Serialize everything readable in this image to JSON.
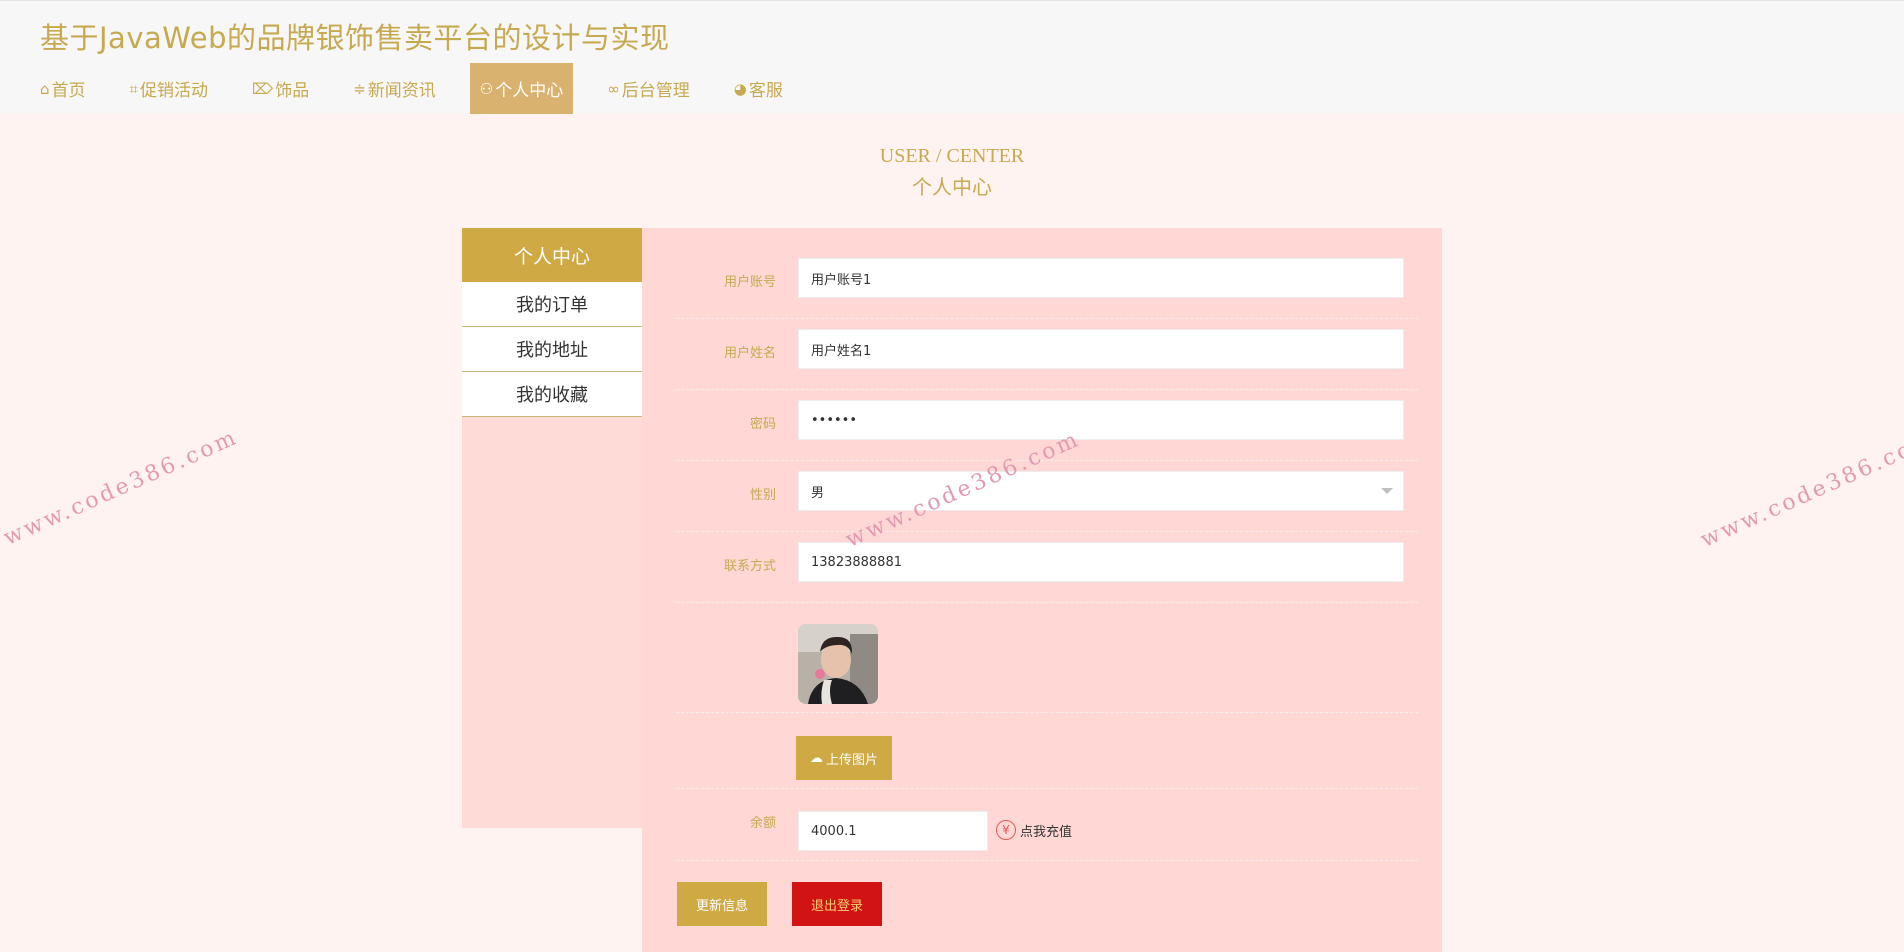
{
  "site": {
    "title": "基于JavaWeb的品牌银饰售卖平台的设计与实现"
  },
  "nav": [
    {
      "label": "首页",
      "icon": "home-icon",
      "glyph": "⌂"
    },
    {
      "label": "促销活动",
      "icon": "promo-icon",
      "glyph": "⌗"
    },
    {
      "label": "饰品",
      "icon": "tag-icon",
      "glyph": "⌦"
    },
    {
      "label": "新闻资讯",
      "icon": "sliders-icon",
      "glyph": "≑"
    },
    {
      "label": "个人中心",
      "icon": "user-icon",
      "glyph": "⚇",
      "active": true
    },
    {
      "label": "后台管理",
      "icon": "link-icon",
      "glyph": "∞"
    },
    {
      "label": "客服",
      "icon": "chat-icon",
      "glyph": "◕"
    }
  ],
  "section": {
    "en": "USER / CENTER",
    "cn": "个人中心"
  },
  "sidebar": {
    "header": "个人中心",
    "items": [
      "我的订单",
      "我的地址",
      "我的收藏"
    ]
  },
  "form": {
    "account": {
      "label": "用户账号",
      "value": "用户账号1"
    },
    "name": {
      "label": "用户姓名",
      "value": "用户姓名1"
    },
    "password": {
      "label": "密码",
      "value": "••••••"
    },
    "gender": {
      "label": "性别",
      "value": "男"
    },
    "contact": {
      "label": "联系方式",
      "value": "13823888881"
    },
    "upload_label": "上传图片",
    "balance": {
      "label": "余额",
      "value": "4000.1"
    },
    "recharge_label": "点我充值",
    "update_label": "更新信息",
    "logout_label": "退出登录"
  },
  "watermark": "www.code386.com",
  "colors": {
    "accent": "#cfa944",
    "nav_active": "#d9b26f",
    "danger": "#d21313",
    "panel": "#ffd7d5"
  }
}
